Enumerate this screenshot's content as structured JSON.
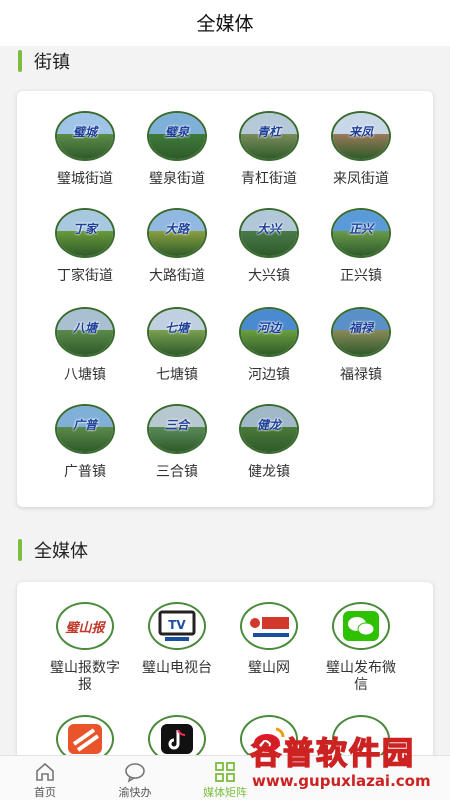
{
  "header": {
    "title": "全媒体"
  },
  "sections": [
    {
      "title": "街镇"
    },
    {
      "title": "全媒体"
    }
  ],
  "towns": [
    {
      "label": "璧城街道",
      "script": "璧城",
      "sky": "#9fc4e8",
      "land": "#5d8c4a"
    },
    {
      "label": "璧泉街道",
      "script": "璧泉",
      "sky": "#7fb0d8",
      "land": "#3f7a3a"
    },
    {
      "label": "青杠街道",
      "script": "青杠",
      "sky": "#b6c9d8",
      "land": "#7a8c5c"
    },
    {
      "label": "来凤街道",
      "script": "来凤",
      "sky": "#c8d8e8",
      "land": "#9a7a5a"
    },
    {
      "label": "丁家街道",
      "script": "丁家",
      "sky": "#a8c8e0",
      "land": "#6a9a3a"
    },
    {
      "label": "大路街道",
      "script": "大路",
      "sky": "#90b8e0",
      "land": "#8aa040"
    },
    {
      "label": "大兴镇",
      "script": "大兴",
      "sky": "#b0c8d8",
      "land": "#4a7a4a"
    },
    {
      "label": "正兴镇",
      "script": "正兴",
      "sky": "#5a9ad8",
      "land": "#6a9a4a"
    },
    {
      "label": "八塘镇",
      "script": "八塘",
      "sky": "#a8c0d0",
      "land": "#5a8a4a"
    },
    {
      "label": "七塘镇",
      "script": "七塘",
      "sky": "#c0d0e0",
      "land": "#7aa050"
    },
    {
      "label": "河边镇",
      "script": "河边",
      "sky": "#4a8ad0",
      "land": "#6aa040"
    },
    {
      "label": "福禄镇",
      "script": "福禄",
      "sky": "#5a90c8",
      "land": "#8a8a5a"
    },
    {
      "label": "广普镇",
      "script": "广普",
      "sky": "#80b0d8",
      "land": "#5a8a4a"
    },
    {
      "label": "三合镇",
      "script": "三合",
      "sky": "#b8c8d0",
      "land": "#5a8a5a"
    },
    {
      "label": "健龙镇",
      "script": "健龙",
      "sky": "#a0b8c8",
      "land": "#4a7a3a"
    }
  ],
  "media": [
    {
      "label": "璧山报数字报",
      "icon": "newspaper-logo-icon",
      "logo_text": "璧山报"
    },
    {
      "label": "璧山电视台",
      "icon": "tv-icon",
      "logo_text": "TV"
    },
    {
      "label": "璧山网",
      "icon": "bishan-web-logo-icon",
      "logo_text": "璧山网"
    },
    {
      "label": "璧山发布微信",
      "icon": "wechat-icon",
      "logo_text": ""
    },
    {
      "label": "",
      "icon": "orange-app-icon",
      "logo_text": ""
    },
    {
      "label": "",
      "icon": "douyin-icon",
      "logo_text": ""
    },
    {
      "label": "",
      "icon": "weibo-icon",
      "logo_text": ""
    },
    {
      "label": "",
      "icon": "newspaper-logo-icon",
      "logo_text": ""
    }
  ],
  "tabbar": [
    {
      "label": "首页",
      "icon": "home-icon"
    },
    {
      "label": "渝快办",
      "icon": "chat-icon"
    },
    {
      "label": "媒体矩阵",
      "icon": "grid-icon",
      "active": true
    }
  ],
  "watermark": {
    "main": "谷普软件园",
    "url": "www.gupuxlazai.com"
  },
  "colors": {
    "accent": "#7cbd3f",
    "watermark": "#cc2222"
  }
}
